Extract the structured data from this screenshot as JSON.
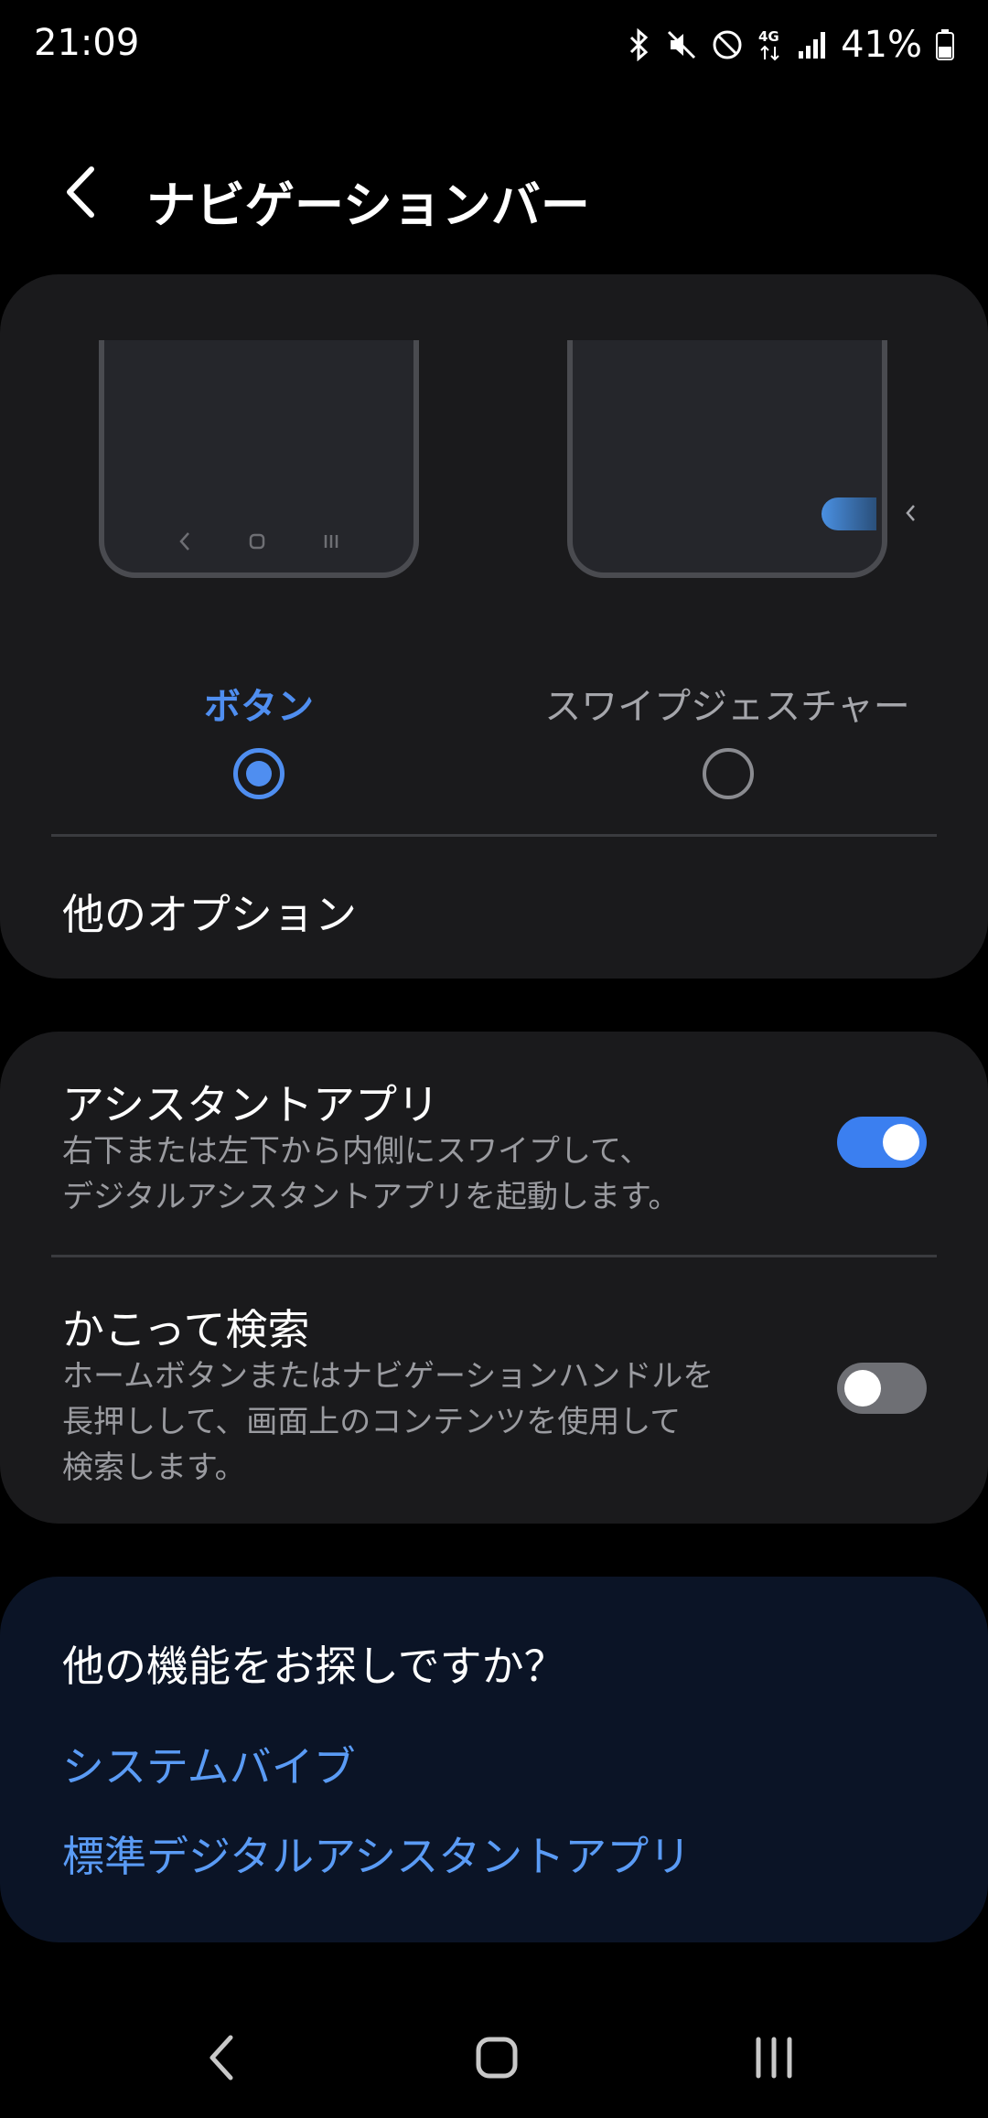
{
  "status_bar": {
    "time": "21:09",
    "icons": [
      "bluetooth-icon",
      "mute-icon",
      "do-not-disturb-icon",
      "4g-icon",
      "signal-icon",
      "battery-icon"
    ],
    "battery": "41%"
  },
  "header": {
    "title": "ナビゲーションバー"
  },
  "nav_type": {
    "options": [
      {
        "label": "ボタン",
        "selected": true
      },
      {
        "label": "スワイプジェスチャー",
        "selected": false
      }
    ],
    "more_options_label": "他のオプション"
  },
  "settings": {
    "assistant": {
      "title": "アシスタントアプリ",
      "description_line1": "右下または左下から内側にスワイプして、",
      "description_line2": "デジタルアシスタントアプリを起動します。",
      "enabled": true
    },
    "circle_search": {
      "title": "かこって検索",
      "description_line1": "ホームボタンまたはナビゲーションハンドルを",
      "description_line2": "長押しして、画面上のコンテンツを使用して",
      "description_line3": "検索します。",
      "enabled": false
    }
  },
  "more_features": {
    "title": "他の機能をお探しですか？",
    "links": [
      "システムバイブ",
      "標準デジタルアシスタントアプリ"
    ]
  },
  "colors": {
    "accent": "#4f8ef0",
    "card_background": "#1a1a1c",
    "link": "#5a9bf5"
  }
}
